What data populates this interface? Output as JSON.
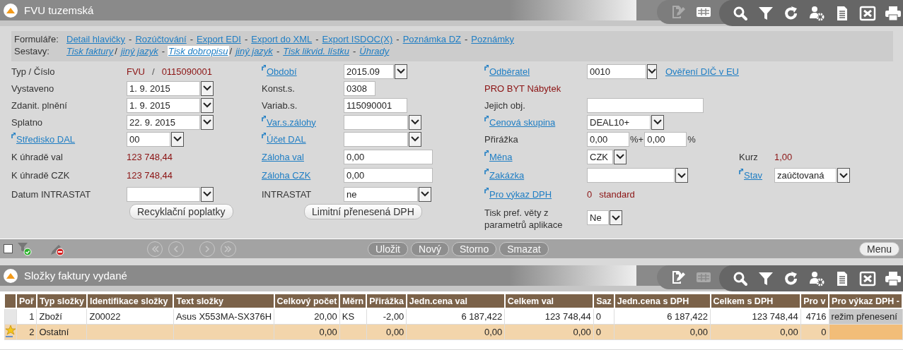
{
  "header": {
    "title": "FVU tuzemská",
    "toolbar": [
      [
        {
          "kind": "edit",
          "disabled": true
        },
        {
          "kind": "table",
          "disabled": false
        }
      ],
      [
        {
          "kind": "search",
          "disabled": false
        },
        {
          "kind": "filter",
          "disabled": false
        },
        {
          "kind": "refresh",
          "disabled": false
        },
        {
          "kind": "user-settings",
          "disabled": false
        },
        {
          "kind": "document",
          "disabled": false
        },
        {
          "kind": "excel",
          "disabled": false
        },
        {
          "kind": "print",
          "disabled": false
        }
      ]
    ]
  },
  "links": [
    {
      "kind": "forms",
      "label": "Formuláře:",
      "items": [
        {
          "text": "Detail hlavičky",
          "separator": "-",
          "selected": false
        },
        {
          "text": "Rozúčtování",
          "separator": "-",
          "selected": false
        },
        {
          "text": "Export EDI",
          "separator": "-",
          "selected": false
        },
        {
          "text": "Export do XML",
          "separator": "-",
          "selected": false
        },
        {
          "text": "Export ISDOC(X)",
          "separator": "-",
          "selected": false
        },
        {
          "text": "Poznámka DZ",
          "separator": "-",
          "selected": false
        },
        {
          "text": "Poznámky",
          "selected": false
        }
      ]
    },
    {
      "kind": "reports",
      "label": "Sestavy:",
      "items": [
        {
          "text": "Tisk faktury",
          "separator": "/",
          "selected": false
        },
        {
          "text": "jiný jazyk",
          "separator": "-",
          "selected": false
        },
        {
          "text": "Tisk dobropisu",
          "separator": "/",
          "selected": true
        },
        {
          "text": "jiný jazyk",
          "separator": "-",
          "selected": false
        },
        {
          "text": "Tisk likvid. lístku",
          "separator": "-",
          "selected": false
        },
        {
          "text": "Úhrady",
          "selected": false
        }
      ]
    }
  ],
  "form": {
    "rows": [
      {
        "left": {
          "label": "Typ / Číslo",
          "link": false,
          "control": {
            "kind": "value",
            "parts": [
              {
                "text": "FVU",
                "emphasis": true
              },
              {
                "text": "/",
                "emphasis": false
              },
              {
                "text": "0115090001",
                "emphasis": true
              }
            ]
          }
        },
        "middle": {
          "label": "Období",
          "link": true,
          "jump": true,
          "control": {
            "kind": "select",
            "value": "2015.09"
          }
        },
        "right": {
          "label": "Odběratel",
          "link": true,
          "jump": true,
          "control": {
            "kind": "select",
            "value": "0010",
            "link": "Ověření DIČ v EU"
          }
        }
      },
      {
        "left": {
          "label": "Vystaveno",
          "link": false,
          "control": {
            "kind": "select",
            "value": "1. 9. 2015"
          }
        },
        "middle": {
          "label": "Konst.s.",
          "link": false,
          "control": {
            "kind": "input",
            "value": "0308"
          }
        },
        "right": {
          "control": {
            "kind": "value",
            "parts": [
              {
                "text": "PRO BYT Nábytek",
                "emphasis": true
              }
            ]
          }
        }
      },
      {
        "left": {
          "label": "Zdanit. plnění",
          "link": false,
          "control": {
            "kind": "select",
            "value": "1. 9. 2015"
          }
        },
        "middle": {
          "label": "Variab.s.",
          "link": false,
          "control": {
            "kind": "input",
            "value": "115090001"
          }
        },
        "right": {
          "label": "Jejich obj.",
          "link": false,
          "control": {
            "kind": "input"
          }
        }
      },
      {
        "left": {
          "label": "Splatno",
          "link": false,
          "control": {
            "kind": "select",
            "value": "22. 9. 2015"
          }
        },
        "middle": {
          "label": "Var.s.zálohy",
          "link": true,
          "jump": true,
          "control": {
            "kind": "select"
          }
        },
        "right": {
          "label": "Cenová skupina",
          "link": true,
          "jump": true,
          "control": {
            "kind": "select",
            "value": "DEAL10+"
          }
        }
      },
      {
        "left": {
          "label": "Středisko DAL",
          "link": true,
          "jump": true,
          "control": {
            "kind": "select",
            "value": "00"
          }
        },
        "middle": {
          "label": "Účet DAL",
          "link": true,
          "jump": true,
          "control": {
            "kind": "select"
          }
        },
        "right": {
          "label": "Přirážka",
          "link": false,
          "control": {
            "kind": "percent_pair",
            "values": [
              "0,00",
              "0,00"
            ],
            "units": [
              "%+",
              "%"
            ]
          }
        }
      },
      {
        "left": {
          "label": "K úhradě val",
          "link": false,
          "control": {
            "kind": "value",
            "parts": [
              {
                "text": "123 748,44",
                "emphasis": true
              }
            ]
          }
        },
        "middle": {
          "label": "Záloha val",
          "link": true,
          "jump": false,
          "control": {
            "kind": "input",
            "value": "0,00"
          }
        },
        "right": {
          "label": "Měna",
          "link": true,
          "jump": true,
          "control": {
            "kind": "select",
            "value": "CZK"
          }
        },
        "extra": {
          "label": "Kurz",
          "link": false,
          "control": {
            "kind": "value",
            "parts": [
              {
                "text": "1,00",
                "emphasis": true
              }
            ]
          }
        }
      },
      {
        "left": {
          "label": "K úhradě CZK",
          "link": false,
          "control": {
            "kind": "value",
            "parts": [
              {
                "text": "123 748,44",
                "emphasis": true
              }
            ]
          }
        },
        "middle": {
          "label": "Záloha CZK",
          "link": true,
          "jump": false,
          "control": {
            "kind": "input",
            "value": "0,00"
          }
        },
        "right": {
          "label": "Zakázka",
          "link": true,
          "jump": true,
          "control": {
            "kind": "select"
          }
        },
        "extra": {
          "label": "Stav",
          "link": true,
          "jump": true,
          "control": {
            "kind": "select",
            "value": "zaúčtovaná"
          }
        }
      },
      {
        "left": {
          "label": "Datum INTRASTAT",
          "link": false,
          "control": {
            "kind": "select"
          }
        },
        "middle": {
          "label": "INTRASTAT",
          "link": false,
          "control": {
            "kind": "select",
            "value": "ne"
          }
        },
        "right": {
          "label": "Pro výkaz DPH",
          "link": true,
          "jump": true,
          "control": {
            "kind": "value",
            "parts": [
              {
                "text": "0",
                "emphasis": true
              },
              {
                "text": "standard",
                "emphasis": true
              }
            ]
          }
        }
      },
      {
        "left": {
          "control": {
            "kind": "button",
            "text": "Recyklační poplatky"
          }
        },
        "middle": {
          "control": {
            "kind": "button",
            "text": "Limitní přenesená DPH"
          }
        },
        "right": {
          "label": "Tisk pref. věty z parametrů aplikace",
          "link": false,
          "control": {
            "kind": "select",
            "value": "Ne"
          }
        }
      }
    ]
  },
  "action_bar": {
    "checked": false,
    "nav": [
      {
        "kind": "first",
        "disabled": true
      },
      {
        "kind": "prev",
        "disabled": true
      },
      {
        "kind": "next",
        "disabled": true
      },
      {
        "kind": "last",
        "disabled": true
      }
    ],
    "buttons": [
      {
        "text": "Uložit",
        "disabled": true
      },
      {
        "text": "Nový",
        "disabled": true
      },
      {
        "text": "Storno",
        "disabled": true
      },
      {
        "text": "Smazat",
        "disabled": true
      }
    ],
    "menu": {
      "text": "Menu",
      "disabled": false
    }
  },
  "items_panel": {
    "title": "Složky faktury vydané",
    "toolbar": [
      [
        {
          "kind": "edit",
          "disabled": false
        },
        {
          "kind": "table",
          "disabled": true
        }
      ],
      [
        {
          "kind": "search",
          "disabled": false
        },
        {
          "kind": "filter",
          "disabled": false
        },
        {
          "kind": "refresh",
          "disabled": false
        },
        {
          "kind": "user-settings",
          "disabled": false
        },
        {
          "kind": "document",
          "disabled": false
        },
        {
          "kind": "excel",
          "disabled": false
        },
        {
          "kind": "print",
          "disabled": false
        }
      ]
    ]
  },
  "table": {
    "columns": [
      "Poř",
      "Typ složky",
      "Identifikace složky",
      "Text složky",
      "Celkový počet",
      "Měrn",
      "Přirážka",
      "Jedn.cena val",
      "Celkem val",
      "Saz",
      "Jedn.cena s DPH",
      "Celkem s DPH",
      "Pro v",
      "Pro výkaz DPH -"
    ],
    "rows": [
      {
        "selected": false,
        "cells": [
          "1",
          "Zboží",
          "Z00022",
          "Asus X553MA-SX376H",
          "20,00",
          "KS",
          "-2,00",
          "6 187,422",
          "123 748,44",
          "0",
          "6 187,422",
          "123 748,44",
          "4716",
          "režim přenesení"
        ]
      },
      {
        "selected": true,
        "cells": [
          "2",
          "Ostatní",
          null,
          null,
          "0,00",
          null,
          "0,00",
          "0,00",
          "0,00",
          "0",
          "0,00",
          "0,00",
          "0",
          null
        ]
      }
    ]
  }
}
